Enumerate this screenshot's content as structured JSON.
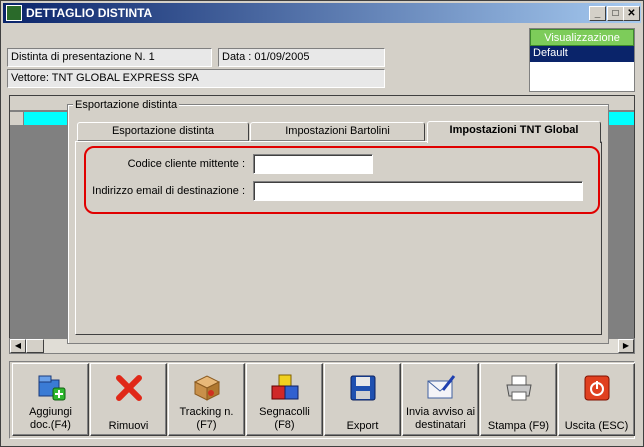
{
  "window": {
    "title": "DETTAGLIO DISTINTA",
    "icon": "app-icon"
  },
  "header": {
    "distinta": "Distinta di presentazione N. 1",
    "data": "Data : 01/09/2005",
    "vettore": "Vettore: TNT GLOBAL EXPRESS SPA"
  },
  "visualizzazione": {
    "header": "Visualizzazione",
    "selected": "Default"
  },
  "grid": {
    "row_highlight_color": "#00ffff"
  },
  "dialog": {
    "group_label": "Esportazione distinta",
    "tabs": [
      {
        "label": "Esportazione distinta"
      },
      {
        "label": "Impostazioni Bartolini"
      },
      {
        "label": "Impostazioni TNT Global"
      }
    ],
    "active_tab": "Impostazioni TNT Global",
    "fields": {
      "codice_label": "Codice cliente mittente :",
      "codice_value": "",
      "email_label": "Indirizzo email di destinazione :",
      "email_value": ""
    },
    "highlight_color": "#e00000"
  },
  "toolbar": {
    "buttons": [
      {
        "label": "Aggiungi\ndoc.(F4)",
        "icon": "add-document-icon"
      },
      {
        "label": "Rimuovi",
        "icon": "remove-icon"
      },
      {
        "label": "Tracking n.\n(F7)",
        "icon": "package-icon"
      },
      {
        "label": "Segnacolli\n(F8)",
        "icon": "boxes-icon"
      },
      {
        "label": "Export",
        "icon": "floppy-disk-icon"
      },
      {
        "label": "Invia avviso ai\ndestinatari",
        "icon": "envelope-icon"
      },
      {
        "label": "Stampa (F9)",
        "icon": "printer-icon"
      },
      {
        "label": "Uscita (ESC)",
        "icon": "exit-icon"
      }
    ]
  }
}
